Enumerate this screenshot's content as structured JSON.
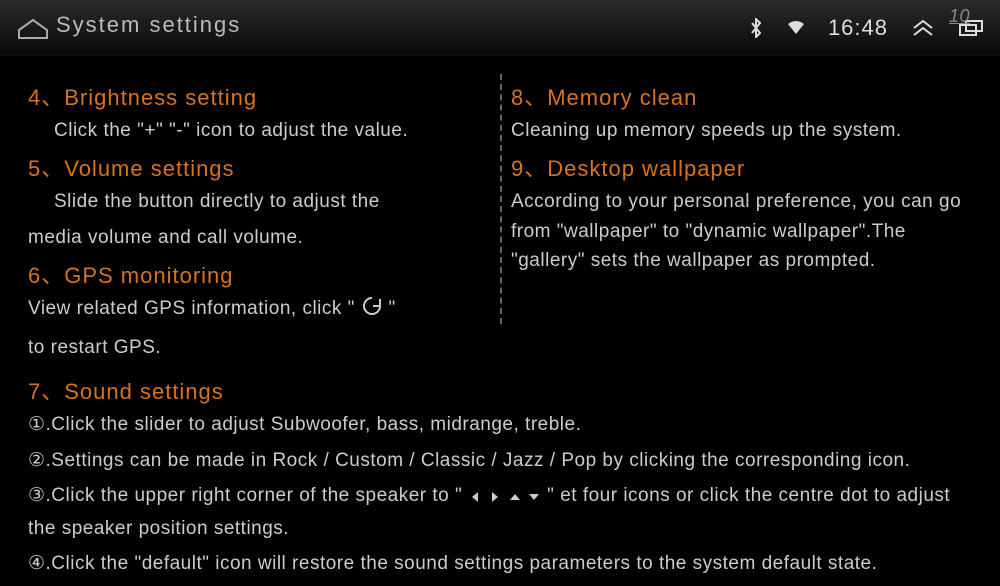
{
  "statusbar": {
    "title": "System settings",
    "clock": "16:48",
    "badge": "10"
  },
  "left": {
    "item4": {
      "heading": "4、Brightness setting",
      "desc": "Click the \"+\" \"-\" icon to adjust the value."
    },
    "item5": {
      "heading": "5、Volume settings",
      "desc_a": "Slide the button directly to adjust the",
      "desc_b": "media volume and call volume."
    },
    "item6": {
      "heading": "6、GPS monitoring",
      "desc_a": "View related GPS information, click \"",
      "desc_b": "\"",
      "desc_c": "to restart GPS."
    }
  },
  "right": {
    "item8": {
      "heading": "8、Memory clean",
      "desc": "Cleaning up memory speeds up the system."
    },
    "item9": {
      "heading": "9、Desktop wallpaper",
      "desc": "According to your personal preference, you can go from \"wallpaper\" to \"dynamic wallpaper\".The \"gallery\" sets the wallpaper as prompted."
    }
  },
  "sound": {
    "heading": "7、Sound settings",
    "item1": "①.Click the slider to adjust Subwoofer, bass, midrange, treble.",
    "item2": "②.Settings can be made in Rock / Custom / Classic / Jazz / Pop by clicking the corresponding icon.",
    "item3_a": "③.Click the upper right corner of the speaker to \"",
    "item3_b": "\" et four icons or click the centre dot to adjust the speaker position settings.",
    "item4": "④.Click the \"default\" icon will restore the sound settings parameters to the system default state."
  }
}
